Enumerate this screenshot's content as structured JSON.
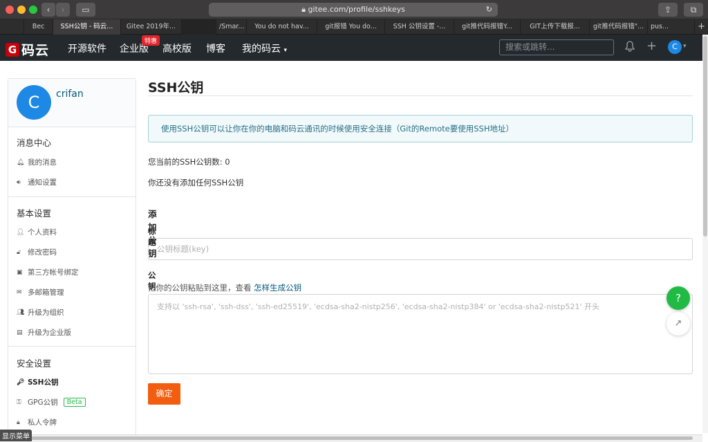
{
  "browser": {
    "url": "gitee.com/profile/sshkeys",
    "tabs": [
      {
        "label": "Bec"
      },
      {
        "label": "SSH公钥 - 码云..."
      },
      {
        "label": "Gitee 2019年..."
      },
      {
        "label": ""
      },
      {
        "label": "/Smar..."
      },
      {
        "label": "You do not hav..."
      },
      {
        "label": "git报错 You do..."
      },
      {
        "label": "SSH 公钥设置 -..."
      },
      {
        "label": "git推代码报错Y..."
      },
      {
        "label": "GIT上传下载报..."
      },
      {
        "label": "git推代码报错\"..."
      },
      {
        "label": "pus..."
      }
    ]
  },
  "nav": {
    "logo": "码云",
    "items": [
      "开源软件",
      "企业版",
      "高校版",
      "博客",
      "我的码云"
    ],
    "badge": "特惠",
    "search_placeholder": "搜索或跳转...",
    "avatar_letter": "C"
  },
  "sidebar": {
    "avatar_letter": "C",
    "username": "crifan",
    "sections": [
      {
        "title": "消息中心",
        "items": [
          "我的消息",
          "通知设置"
        ]
      },
      {
        "title": "基本设置",
        "items": [
          "个人资料",
          "修改密码",
          "第三方帐号绑定",
          "多邮箱管理",
          "升级为组织",
          "升级为企业版"
        ]
      },
      {
        "title": "安全设置",
        "items": [
          "SSH公钥",
          "GPG公钥",
          "私人令牌"
        ]
      }
    ],
    "beta": "Beta",
    "show_menu": "显示菜单"
  },
  "main": {
    "title": "SSH公钥",
    "info": "使用SSH公钥可以让你在你的电脑和码云通讯的时候使用安全连接（Git的Remote要使用SSH地址）",
    "count_text": "您当前的SSH公钥数: 0",
    "none_text": "你还没有添加任何SSH公钥",
    "add_title": "添加公钥",
    "title_label": "标题",
    "title_placeholder": "公钥标题(key)",
    "key_label": "公钥",
    "key_hint": "把你的公钥粘贴到这里，查看",
    "key_hint_link": "怎样生成公钥",
    "key_placeholder": "支持以 'ssh-rsa', 'ssh-dss', 'ssh-ed25519', 'ecdsa-sha2-nistp256', 'ecdsa-sha2-nistp384' or 'ecdsa-sha2-nistp521' 开头",
    "submit": "确定"
  },
  "float": {
    "help": "?"
  }
}
